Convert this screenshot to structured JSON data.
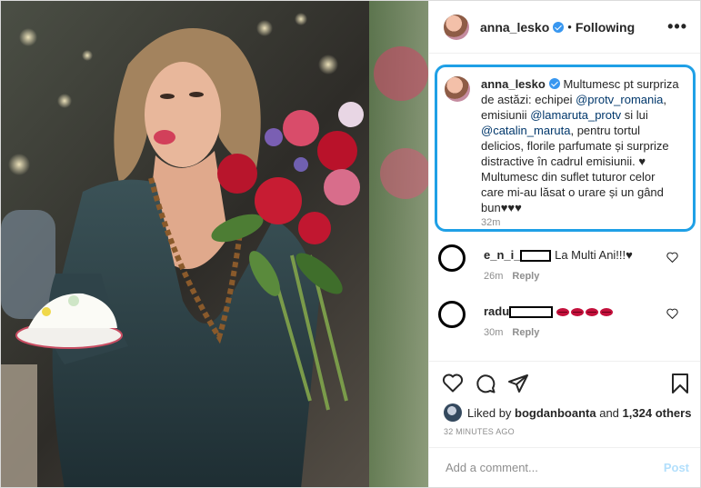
{
  "post": {
    "author": "anna_lesko",
    "follow_separator": "•",
    "follow_status": "Following",
    "more_glyph": "•••"
  },
  "caption": {
    "username": "anna_lesko",
    "text_1": "Multumesc pt surpriza de astăzi: echipei ",
    "mention_1": "@protv_romania",
    "text_2": ", emisiunii ",
    "mention_2": "@lamaruta_protv",
    "text_3": " si lui ",
    "mention_3": "@catalin_maruta",
    "text_4": ", pentru tortul delicios, florile parfumate și surprize distractive în cadrul emisiunii. ♥ Multumesc din suflet tuturor celor care mi-au lăsat o urare și un gând bun♥♥♥",
    "time": "32m"
  },
  "comments": [
    {
      "username": "e_n_i_",
      "text": "La Multi Ani!!!♥",
      "time": "26m",
      "reply": "Reply"
    },
    {
      "username": "radu",
      "text": "",
      "time": "30m",
      "reply": "Reply"
    }
  ],
  "likes": {
    "prefix": "Liked by ",
    "user": "bogdanboanta",
    "conjunction": " and ",
    "others": "1,324 others"
  },
  "timestamp": "32 MINUTES AGO",
  "add_comment": {
    "placeholder": "Add a comment...",
    "post_label": "Post"
  },
  "colors": {
    "highlight_border": "#1fa0e6",
    "mention": "#00376b",
    "verified": "#3897f0",
    "post_button_disabled": "#b2dffc"
  }
}
